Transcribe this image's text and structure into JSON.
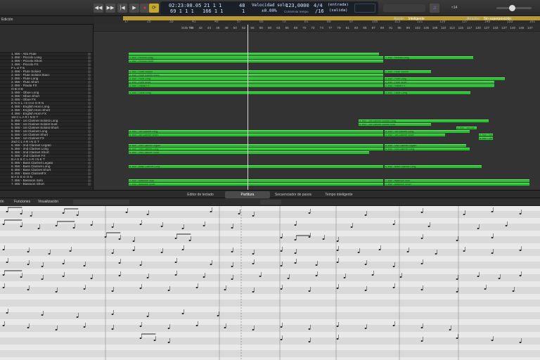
{
  "transport": {
    "buttons": [
      "rewind",
      "fast-forward",
      "to-start",
      "play",
      "record",
      "cycle"
    ],
    "lcd": {
      "time": "02:23:08.05",
      "time_sub": "69 1 1 1",
      "bar_beat": "21 1 1",
      "bar_beat_sub": "166 1 1",
      "div": "48",
      "div_sub": "1",
      "solo_label": "Velocidad solo",
      "solo_sub": "±0.00%",
      "tempo": "123,0000",
      "tempo_sub": "Conservar tempo",
      "sig": "4/4",
      "sig_sub": "/16",
      "in_label": "(entrada)",
      "out_label": "(salida)"
    },
    "cpu_label": "≈14"
  },
  "trackbar": {
    "ajuste_label": "Ajuste:",
    "ajuste_value": "Inteligente",
    "arrastre_label": "Arrastre:",
    "arrastre_value": "Sin superposición",
    "ruler_numbers": [
      "17",
      "25",
      "33",
      "41",
      "49",
      "57",
      "65",
      "73",
      "81",
      "89",
      "97",
      "105",
      "113",
      "121",
      "129",
      "137",
      "145",
      "153",
      "161"
    ]
  },
  "marker_numbers": [
    "Solo Tin",
    "40",
    "42",
    "44",
    "46",
    "48",
    "50",
    "52",
    "55",
    "58",
    "60",
    "63",
    "65",
    "68",
    "70",
    "72",
    "74",
    "77",
    "79",
    "81",
    "83",
    "85",
    "87",
    "89",
    "91",
    "95",
    "99",
    "102",
    "105",
    "108",
    "110",
    "113",
    "115",
    "117",
    "120",
    "127",
    "133",
    "137",
    "140",
    "145",
    "147"
  ],
  "tracks": [
    "1. BW - Alto Flute",
    "1. BW - Piccolo Long",
    "1. BW - Piccolo Short",
    "1. BW - Piccolo FX",
    "F L U T E",
    "2. BW - Flute Soloist",
    "2. BW - Flute Soloist Stacc",
    "2. BW - Flute Long",
    "2. BW - Flute Short",
    "2. BW - Flauta FX",
    "O B O E",
    "3. BW - Oboe Long",
    "3. BW - Oboe Short",
    "3. BW - Oboe FX",
    "E N G L I S H   H O R N",
    "4. BW - English Horn Long",
    "4. BW - English Horn Short",
    "4. BW - English Horn FX",
    "1st  C L A R I N E T",
    "5. BW - 1st Clarinet Soloist Long",
    "5. BW - 1st Clarinet Soloist Sust",
    "5. BW - 1st Clarinet Soloist Short",
    "5. BW - 1st Clarinet Long",
    "5. BW - 1st Clarinet Short",
    "6. BW - 1st Clarinet FX",
    "2nd  C L A R I N E T",
    "6. BW - 2nd Clarinet Legato",
    "6. BW - 2nd Clarinet Long",
    "6. BW - 2nd Clarinet Short",
    "6. BW - 2nd Clarinet FX",
    "B A S S   C L A R I N E T",
    "6. BW - Bass Clarinet Legato",
    "6. BW - Bass Clarinet Long",
    "6. BW - Bass Clarinet Short",
    "6. BW - Bass ClarinetFX",
    "B A S S O O N",
    "7. BW - Bassoon Solo",
    "7. BW - Bassoon Short"
  ],
  "regions": [
    {
      "label": "",
      "row": 0,
      "l": 50,
      "r": 406
    },
    {
      "label": "1. BW - Piccolo Long",
      "row": 1,
      "l": 50,
      "r": 412
    },
    {
      "label": "1. BW - Piccolo Long",
      "row": 1,
      "l": 414,
      "r": 540
    },
    {
      "label": "1. BW - Piccolo Short",
      "row": 2,
      "l": 50,
      "r": 412
    },
    {
      "label": "2. BW - Flute Soloist",
      "row": 5,
      "l": 50,
      "r": 412
    },
    {
      "label": "2. BW - Flute Soloist",
      "row": 5,
      "l": 414,
      "r": 480
    },
    {
      "label": "2. BW - Flute Soloist Stacc",
      "row": 6,
      "l": 50,
      "r": 412
    },
    {
      "label": "2. BW - Flute Long",
      "row": 7,
      "l": 50,
      "r": 412
    },
    {
      "label": "2. BW - Flute Long",
      "row": 7,
      "l": 414,
      "r": 585
    },
    {
      "label": "2. BW - Flute Short",
      "row": 8,
      "l": 50,
      "r": 412
    },
    {
      "label": "2. BW - Flute Short",
      "row": 8,
      "l": 414,
      "r": 570
    },
    {
      "label": "2. BW - Flauta FX",
      "row": 9,
      "l": 50,
      "r": 412
    },
    {
      "label": "2. BW - Flauta FX",
      "row": 9,
      "l": 414,
      "r": 570
    },
    {
      "label": "3. BW - Oboe Long",
      "row": 11,
      "l": 50,
      "r": 412
    },
    {
      "label": "3. BW - Oboe Long",
      "row": 11,
      "l": 414,
      "r": 536
    },
    {
      "label": "5. BW - 1st Clarinet Soloist Long",
      "row": 19,
      "l": 377,
      "r": 562
    },
    {
      "label": "5. BW - 1st Clarinet Soloist Sust",
      "row": 20,
      "l": 377,
      "r": 480
    },
    {
      "label": "5. BW - 1st Cla",
      "row": 21,
      "l": 516,
      "r": 545
    },
    {
      "label": "5. BW - 1st Clarinet Long",
      "row": 22,
      "l": 50,
      "r": 412
    },
    {
      "label": "5. BW - 1st Clarinet Long",
      "row": 22,
      "l": 414,
      "r": 535
    },
    {
      "label": "5. BW - 1st Clarinet Short",
      "row": 23,
      "l": 50,
      "r": 412
    },
    {
      "label": "5. BW - 1st Clarinet Short",
      "row": 23,
      "l": 414,
      "r": 500
    },
    {
      "label": "5. BW - 1st",
      "row": 23,
      "l": 548,
      "r": 568
    },
    {
      "label": "5. BW - 1st",
      "row": 24,
      "l": 548,
      "r": 568
    },
    {
      "label": "6. BW - 2nd Clarinet Legato",
      "row": 26,
      "l": 50,
      "r": 412
    },
    {
      "label": "6. BW - 2nd Clarinet Legato",
      "row": 26,
      "l": 414,
      "r": 530
    },
    {
      "label": "6. BW - 2nd Clarinet Long",
      "row": 27,
      "l": 50,
      "r": 412
    },
    {
      "label": "6. BW - 2nd Clarinet Long",
      "row": 27,
      "l": 414,
      "r": 535
    },
    {
      "label": "6. BW - 2nd Clarinet Short",
      "row": 28,
      "l": 50,
      "r": 392
    },
    {
      "label": "6. BW - Bass Clarinet Long",
      "row": 32,
      "l": 50,
      "r": 412
    },
    {
      "label": "6. BW - Bass Clarinet Long",
      "row": 32,
      "l": 414,
      "r": 552
    },
    {
      "label": "7. BW - Bassoon Solo",
      "row": 36,
      "l": 50,
      "r": 412
    },
    {
      "label": "7. BW - Bassoon Solo",
      "row": 36,
      "l": 414,
      "r": 620
    },
    {
      "label": "7. BW - Bassoon Short",
      "row": 37,
      "l": 50,
      "r": 412
    },
    {
      "label": "7. BW - Bassoon Short",
      "row": 37,
      "l": 414,
      "r": 620
    }
  ],
  "tabs": [
    {
      "label": "Editor de teclado",
      "active": false
    },
    {
      "label": "Partitura",
      "active": true
    },
    {
      "label": "Secuenciador de pasos",
      "active": false
    },
    {
      "label": "Tempo inteligente",
      "active": false
    }
  ],
  "scorebar": {
    "edicion": "ón",
    "funciones": "Funciones",
    "visualizacion": "Visualización"
  },
  "colors": {
    "region": "#23c02b",
    "cycle": "#b89a2e",
    "score_bg": "#e9e9e9"
  }
}
